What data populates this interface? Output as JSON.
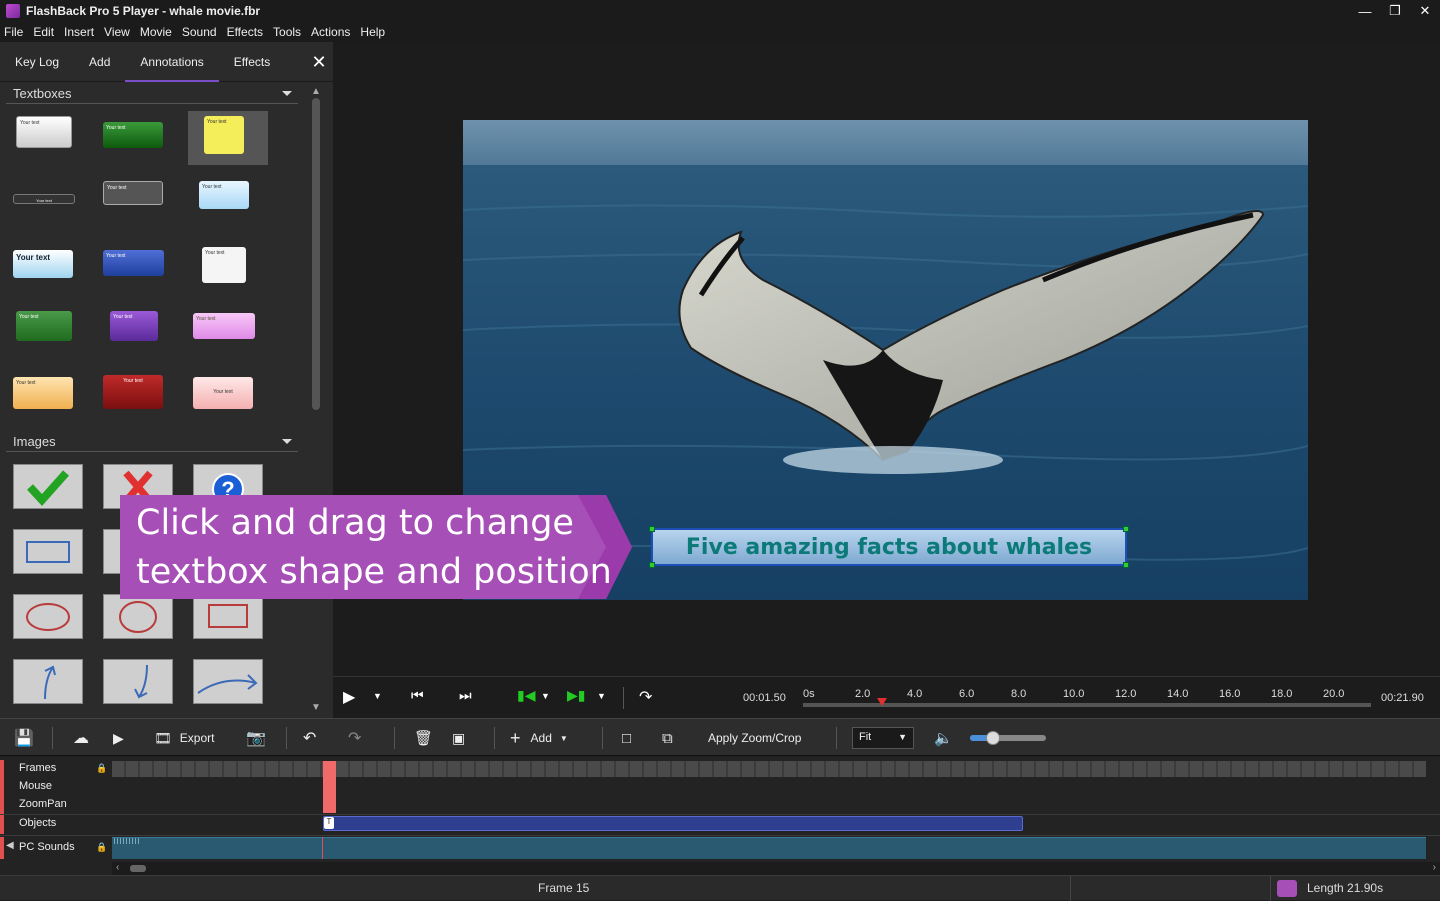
{
  "window": {
    "title": "FlashBack Pro 5 Player - whale movie.fbr"
  },
  "menu": [
    "File",
    "Edit",
    "Insert",
    "View",
    "Movie",
    "Sound",
    "Effects",
    "Tools",
    "Actions",
    "Help"
  ],
  "panel": {
    "tabs": [
      "Key Log",
      "Add",
      "Annotations",
      "Effects"
    ],
    "active_tab": "Annotations",
    "sections": {
      "textboxes": "Textboxes",
      "images": "Images"
    },
    "textbox_sample": "Your text"
  },
  "video": {
    "annotation_text": "Five amazing facts about whales"
  },
  "tooltip": {
    "line1": "Click and drag to change",
    "line2": "textbox shape and position"
  },
  "transport": {
    "current_time": "00:01.50",
    "total_time": "00:21.90",
    "ruler_labels": [
      "0s",
      "2.0",
      "4.0",
      "6.0",
      "8.0",
      "10.0",
      "12.0",
      "14.0",
      "16.0",
      "18.0",
      "20.0"
    ],
    "playhead_seconds": 1.5
  },
  "toolbar": {
    "export_label": "Export",
    "add_label": "Add",
    "apply_zoom_label": "Apply Zoom/Crop",
    "fit_value": "Fit",
    "volume_percent": 30
  },
  "tracks": [
    "Frames",
    "Mouse",
    "ZoomPan",
    "Objects",
    "PC Sounds"
  ],
  "status": {
    "frame": "Frame 15",
    "length": "Length 21.90s"
  }
}
